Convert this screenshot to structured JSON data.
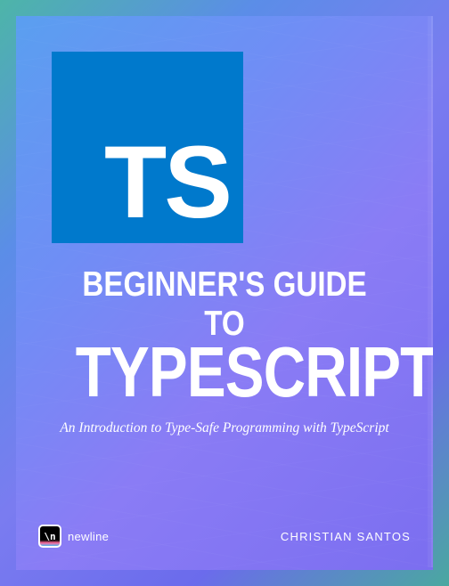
{
  "logo": {
    "text": "TS"
  },
  "title": {
    "line1": "BEGINNER'S GUIDE TO",
    "line2": "TYPESCRIPT"
  },
  "subtitle": "An Introduction to Type-Safe Programming with TypeScript",
  "publisher": {
    "logo_text": "\\n",
    "name": "newline"
  },
  "author": "CHRISTIAN SANTOS"
}
